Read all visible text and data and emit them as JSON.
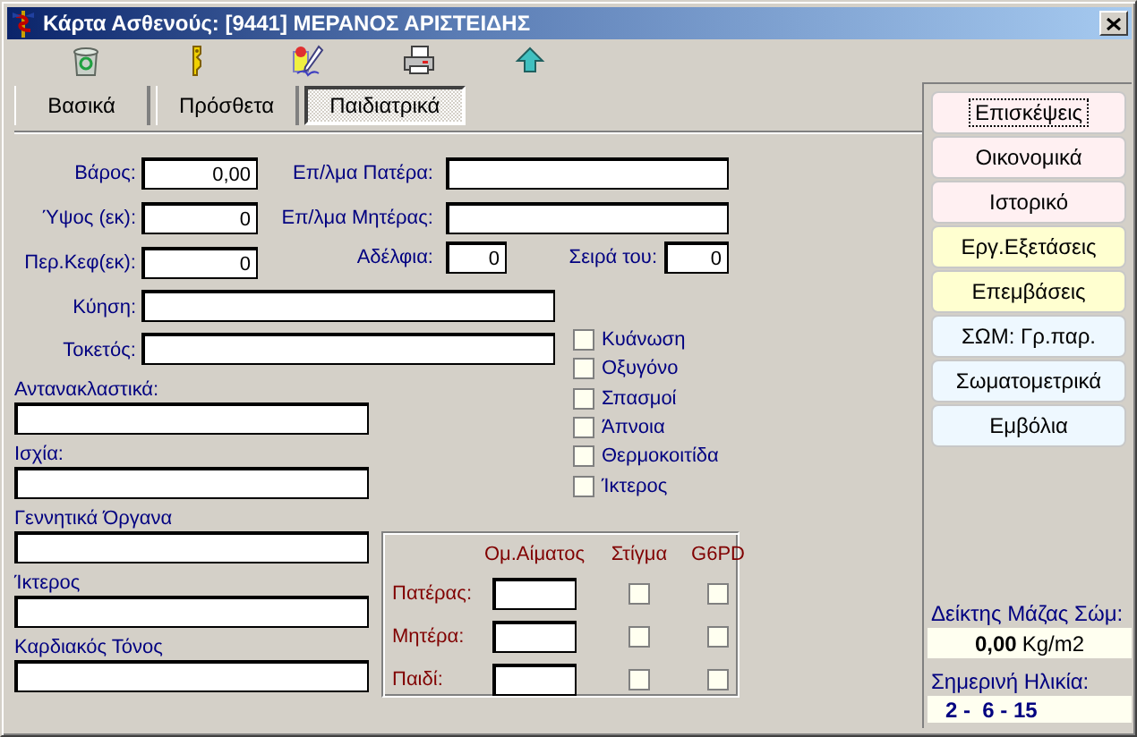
{
  "window": {
    "title": "Κάρτα Ασθενούς: [9441] ΜΕΡΑΝΟΣ ΑΡΙΣΤΕΙΔΗΣ"
  },
  "toolbar": [
    {
      "kind": "recycle"
    },
    {
      "kind": "key"
    },
    {
      "kind": "pen"
    },
    {
      "kind": "printer"
    },
    {
      "kind": "up"
    }
  ],
  "tabs": [
    {
      "label": "Βασικά",
      "selected": false
    },
    {
      "label": "Πρόσθετα",
      "selected": false
    },
    {
      "label": "Παιδιατρικά",
      "selected": true
    }
  ],
  "measurements": [
    {
      "label": "Βάρος:",
      "value": "0,00"
    },
    {
      "label": "Ύψος (εκ):",
      "value": "0"
    },
    {
      "label": "Περ.Κεφ(εκ):",
      "value": "0"
    }
  ],
  "parents_jobs": [
    {
      "label": "Επ/λμα Πατέρα:"
    },
    {
      "label": "Επ/λμα Μητέρας:"
    }
  ],
  "siblings": {
    "label": "Αδέλφια:",
    "value": "0"
  },
  "birth_order": {
    "label": "Σειρά του:",
    "value": "0"
  },
  "pregnancy": {
    "label": "Κύηση:"
  },
  "delivery": {
    "label": "Τοκετός:"
  },
  "symptoms": [
    {
      "label": "Κυάνωση",
      "checked": false
    },
    {
      "label": "Οξυγόνο",
      "checked": false
    },
    {
      "label": "Σπασμοί",
      "checked": false
    },
    {
      "label": "Άπνοια",
      "checked": false
    },
    {
      "label": "Θερμοκοιτίδα",
      "checked": false
    },
    {
      "label": "Ίκτερος",
      "checked": false
    }
  ],
  "notes": [
    {
      "label": "Αντανακλαστικά:"
    },
    {
      "label": "Ισχία:"
    },
    {
      "label": "Γεννητικά Όργανα"
    },
    {
      "label": "Ίκτερος"
    },
    {
      "label": "Καρδιακός Τόνος"
    }
  ],
  "blood": {
    "columns": [
      "Ομ.Αίματος",
      "Στίγμα",
      "G6PD"
    ],
    "rows": [
      {
        "label": "Πατέρας:",
        "trait": false,
        "g6pd": false
      },
      {
        "label": "Μητέρα:",
        "trait": false,
        "g6pd": false
      },
      {
        "label": "Παιδί:",
        "trait": false,
        "g6pd": false
      }
    ]
  },
  "side_buttons": [
    {
      "label": "Επισκέψεις",
      "color": "#fff0f2",
      "focused": true
    },
    {
      "label": "Οικονομικά",
      "color": "#fff0f2",
      "focused": false
    },
    {
      "label": "Ιστορικό",
      "color": "#fff0f2",
      "focused": false
    },
    {
      "label": "Εργ.Εξετάσεις",
      "color": "#ffffd0",
      "focused": false
    },
    {
      "label": "Επεμβάσεις",
      "color": "#ffffd0",
      "focused": false
    },
    {
      "label": "ΣΩΜ: Γρ.παρ.",
      "color": "#eef8ff",
      "focused": false
    },
    {
      "label": "Σωματομετρικά",
      "color": "#eef8ff",
      "focused": false
    },
    {
      "label": "Εμβόλια",
      "color": "#eef8ff",
      "focused": false
    }
  ],
  "bmi": {
    "label": "Δείκτης Μάζας Σώμ:",
    "value": "0,00",
    "unit": "Kg/m2"
  },
  "age": {
    "label": "Σημερινή Ηλικία:",
    "value": "2 -  6 - 15"
  }
}
